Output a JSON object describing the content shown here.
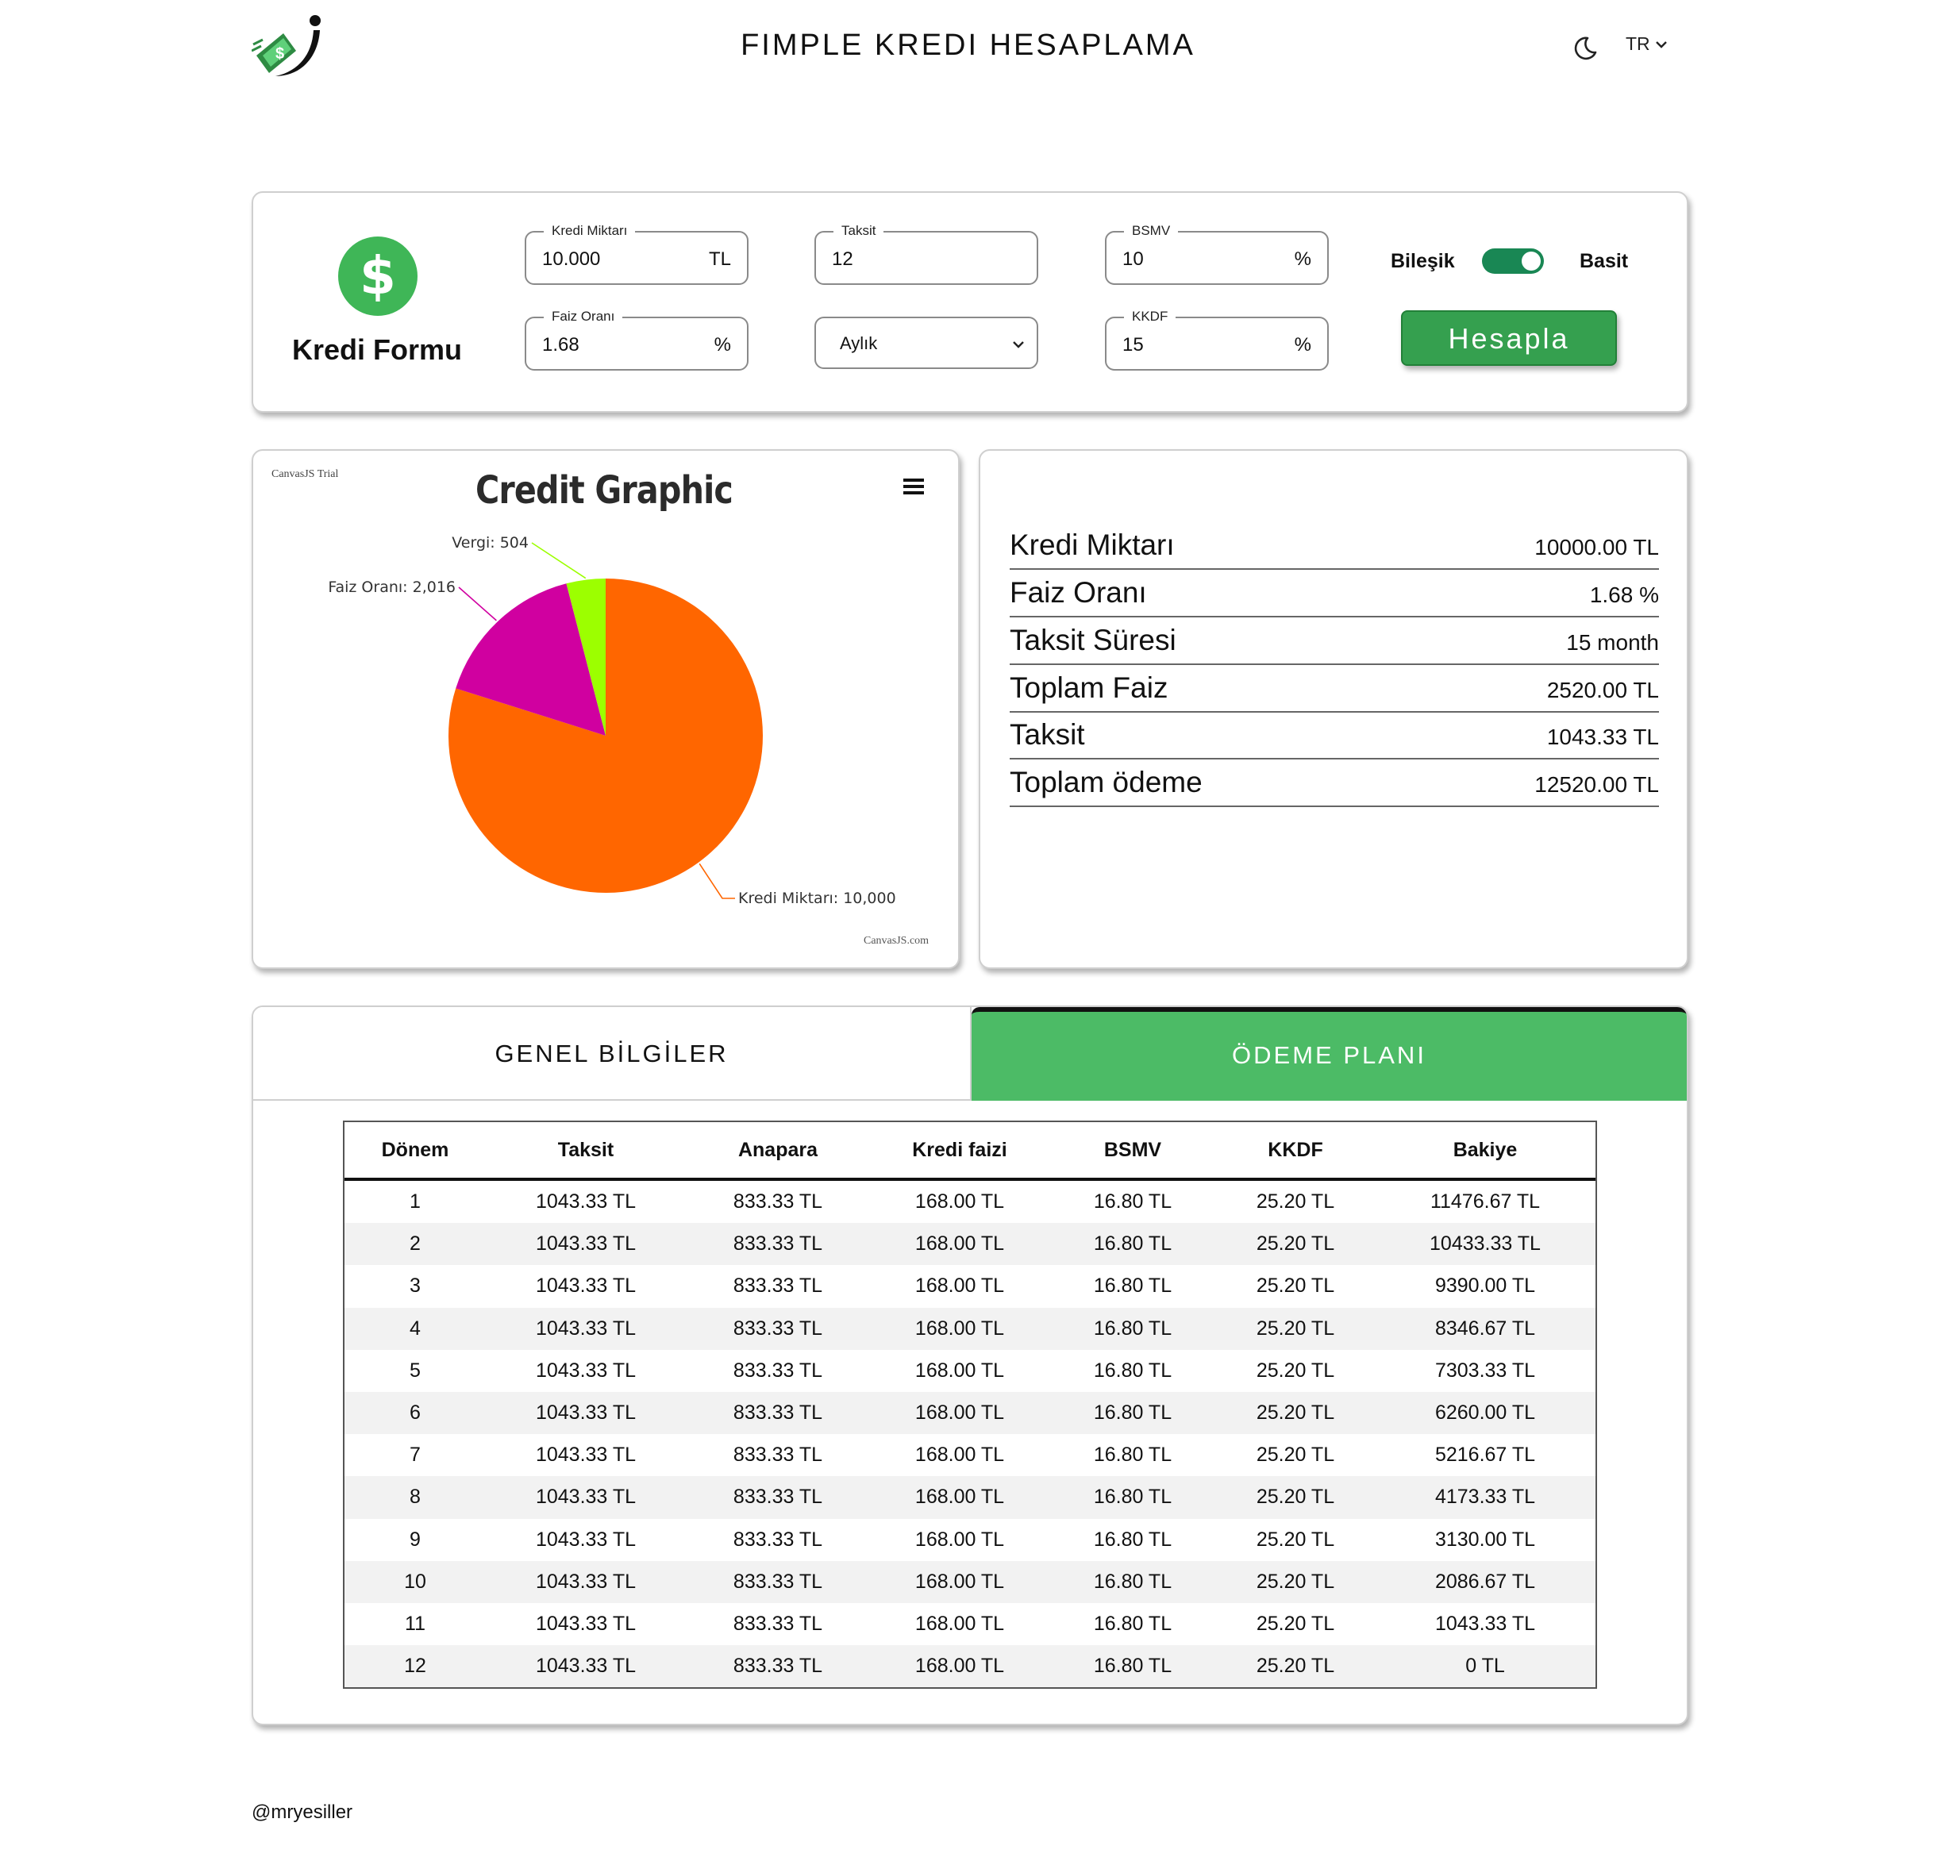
{
  "header": {
    "title": "FIMPLE KREDI HESAPLAMA",
    "language": "TR"
  },
  "colors": {
    "accent_green": "#35a04f",
    "tab_active": "#4cbb66",
    "switch_on": "#198754",
    "pie_kredi": "#ff6600",
    "pie_faiz": "#d000a0",
    "pie_vergi": "#9cff00"
  },
  "form": {
    "title": "Kredi Formu",
    "kredi_miktari": {
      "label": "Kredi Miktarı",
      "value": "10.000",
      "unit": "TL"
    },
    "taksit": {
      "label": "Taksit",
      "value": "12"
    },
    "bsmv": {
      "label": "BSMV",
      "value": "10",
      "unit": "%"
    },
    "faiz_orani": {
      "label": "Faiz Oranı",
      "value": "1.68",
      "unit": "%"
    },
    "period": {
      "selected": "Aylık"
    },
    "kkdf": {
      "label": "KKDF",
      "value": "15",
      "unit": "%"
    },
    "toggle": {
      "left_label": "Bileşik",
      "right_label": "Basit",
      "on": true
    },
    "submit_label": "Hesapla"
  },
  "chart_branding": {
    "trial": "CanvasJS Trial",
    "credit": "CanvasJS.com"
  },
  "chart_data": {
    "type": "pie",
    "title": "Credit Graphic",
    "slices": [
      {
        "label": "Kredi Miktarı",
        "value": 10000,
        "display": "Kredi Miktarı: 10,000",
        "color": "#ff6600"
      },
      {
        "label": "Faiz Oranı",
        "value": 2016,
        "display": "Faiz Oranı: 2,016",
        "color": "#d000a0"
      },
      {
        "label": "Vergi",
        "value": 504,
        "display": "Vergi: 504",
        "color": "#9cff00"
      }
    ]
  },
  "summary": {
    "rows": [
      {
        "label": "Kredi Miktarı",
        "value": "10000.00 TL"
      },
      {
        "label": "Faiz Oranı",
        "value": "1.68 %"
      },
      {
        "label": "Taksit Süresi",
        "value": "15 month"
      },
      {
        "label": "Toplam Faiz",
        "value": "2520.00 TL"
      },
      {
        "label": "Taksit",
        "value": "1043.33 TL"
      },
      {
        "label": "Toplam ödeme",
        "value": "12520.00 TL"
      }
    ]
  },
  "tabs": [
    {
      "label": "GENEL BİLGİLER",
      "active": false
    },
    {
      "label": "ÖDEME PLANI",
      "active": true
    }
  ],
  "table": {
    "headers": [
      "Dönem",
      "Taksit",
      "Anapara",
      "Kredi faizi",
      "BSMV",
      "KKDF",
      "Bakiye"
    ],
    "rows": [
      [
        "1",
        "1043.33 TL",
        "833.33 TL",
        "168.00 TL",
        "16.80 TL",
        "25.20 TL",
        "11476.67 TL"
      ],
      [
        "2",
        "1043.33 TL",
        "833.33 TL",
        "168.00 TL",
        "16.80 TL",
        "25.20 TL",
        "10433.33 TL"
      ],
      [
        "3",
        "1043.33 TL",
        "833.33 TL",
        "168.00 TL",
        "16.80 TL",
        "25.20 TL",
        "9390.00 TL"
      ],
      [
        "4",
        "1043.33 TL",
        "833.33 TL",
        "168.00 TL",
        "16.80 TL",
        "25.20 TL",
        "8346.67 TL"
      ],
      [
        "5",
        "1043.33 TL",
        "833.33 TL",
        "168.00 TL",
        "16.80 TL",
        "25.20 TL",
        "7303.33 TL"
      ],
      [
        "6",
        "1043.33 TL",
        "833.33 TL",
        "168.00 TL",
        "16.80 TL",
        "25.20 TL",
        "6260.00 TL"
      ],
      [
        "7",
        "1043.33 TL",
        "833.33 TL",
        "168.00 TL",
        "16.80 TL",
        "25.20 TL",
        "5216.67 TL"
      ],
      [
        "8",
        "1043.33 TL",
        "833.33 TL",
        "168.00 TL",
        "16.80 TL",
        "25.20 TL",
        "4173.33 TL"
      ],
      [
        "9",
        "1043.33 TL",
        "833.33 TL",
        "168.00 TL",
        "16.80 TL",
        "25.20 TL",
        "3130.00 TL"
      ],
      [
        "10",
        "1043.33 TL",
        "833.33 TL",
        "168.00 TL",
        "16.80 TL",
        "25.20 TL",
        "2086.67 TL"
      ],
      [
        "11",
        "1043.33 TL",
        "833.33 TL",
        "168.00 TL",
        "16.80 TL",
        "25.20 TL",
        "1043.33 TL"
      ],
      [
        "12",
        "1043.33 TL",
        "833.33 TL",
        "168.00 TL",
        "16.80 TL",
        "25.20 TL",
        "0 TL"
      ]
    ]
  },
  "footer": {
    "credit": "@mryesiller"
  }
}
